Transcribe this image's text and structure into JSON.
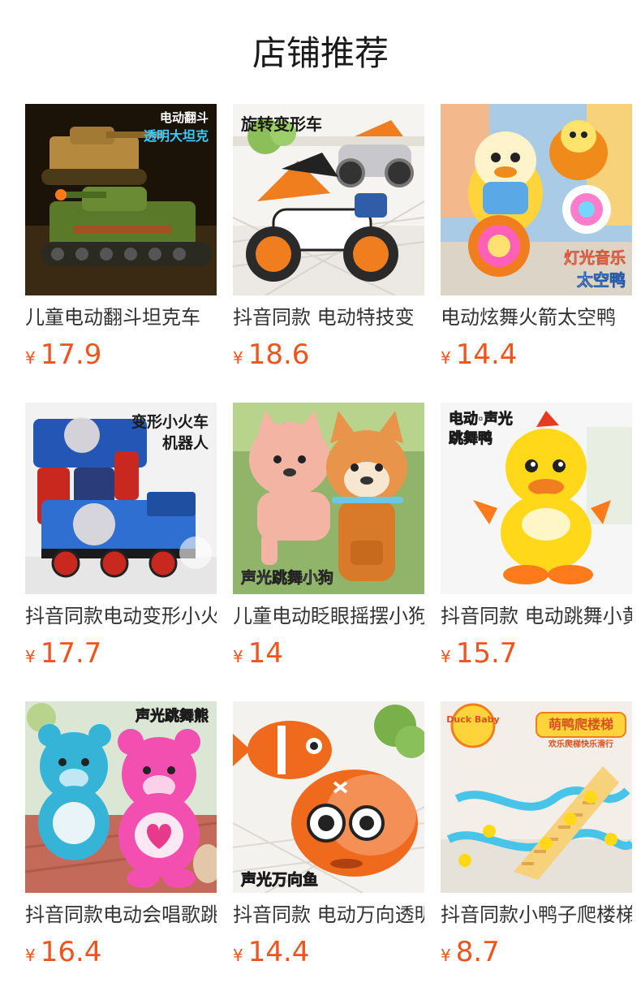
{
  "page": {
    "title": "店铺推荐"
  },
  "theme": {
    "price_color": "#f0531c",
    "title_color": "#333333"
  },
  "products": [
    {
      "name": "儿童电动翻斗坦克车",
      "currency": "¥",
      "price": "17.9",
      "image_text": [
        "电动翻斗",
        "透明大坦克"
      ],
      "image_icon": "tank-toy-image"
    },
    {
      "name": "抖音同款 电动特技变",
      "currency": "¥",
      "price": "18.6",
      "image_text": [
        "旋转变形车"
      ],
      "image_icon": "motorcycle-toy-image"
    },
    {
      "name": "电动炫舞火箭太空鸭",
      "currency": "¥",
      "price": "14.4",
      "image_text": [
        "灯光音乐",
        "太空鸭"
      ],
      "image_icon": "space-duck-toy-image"
    },
    {
      "name": "抖音同款电动变形小火",
      "currency": "¥",
      "price": "17.7",
      "image_text": [
        "变形小火车",
        "机器人"
      ],
      "image_icon": "train-robot-toy-image"
    },
    {
      "name": "儿童电动眨眼摇摆小狗",
      "currency": "¥",
      "price": "14",
      "image_text": [
        "声光跳舞小狗"
      ],
      "image_icon": "dog-toy-image"
    },
    {
      "name": "抖音同款 电动跳舞小黄",
      "currency": "¥",
      "price": "15.7",
      "image_text": [
        "电动·声光",
        "跳舞鸭"
      ],
      "image_icon": "dancing-duck-toy-image"
    },
    {
      "name": "抖音同款电动会唱歌跳",
      "currency": "¥",
      "price": "16.4",
      "image_text": [
        "声光跳舞熊"
      ],
      "image_icon": "bear-toy-image"
    },
    {
      "name": "抖音同款 电动万向透明",
      "currency": "¥",
      "price": "14.4",
      "image_text": [
        "声光万向鱼"
      ],
      "image_icon": "fish-toy-image"
    },
    {
      "name": "抖音同款小鸭子爬楼梯",
      "currency": "¥",
      "price": "8.7",
      "image_text": [
        "萌鸭爬楼梯",
        "欢乐爬梯快乐滑行",
        "Duck Baby"
      ],
      "image_icon": "duck-stairs-toy-image"
    }
  ]
}
